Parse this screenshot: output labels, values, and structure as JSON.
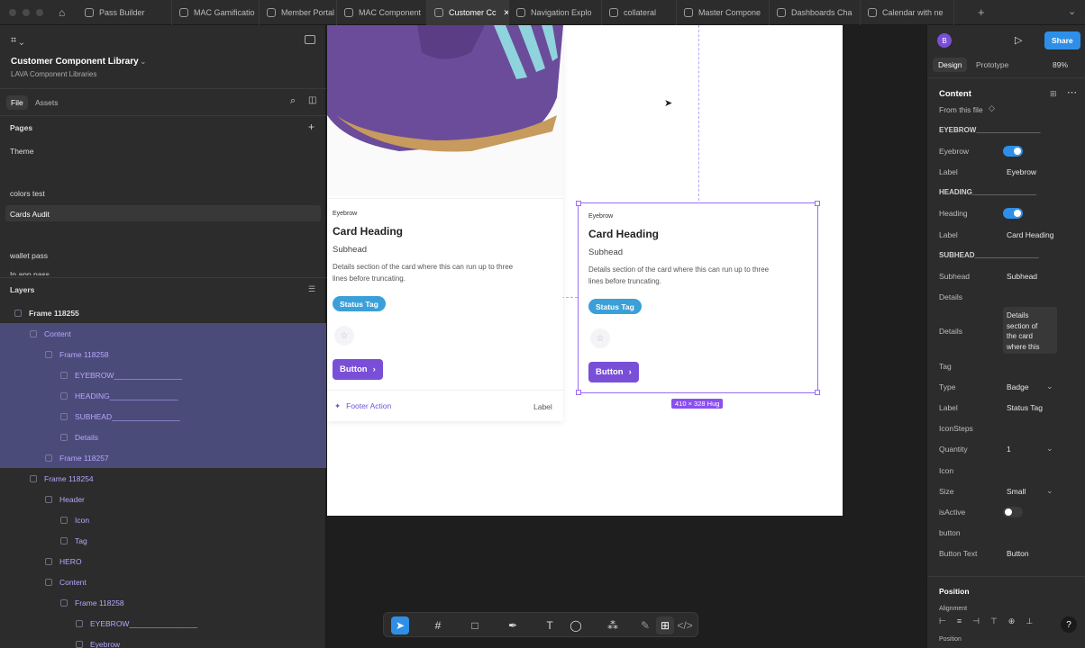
{
  "tabs": [
    {
      "label": "Pass Builder"
    },
    {
      "label": "MAC Gamificatio"
    },
    {
      "label": "Member Portal"
    },
    {
      "label": "MAC Component"
    },
    {
      "label": "Customer Cc",
      "active": true
    },
    {
      "label": "Navigation Explo"
    },
    {
      "label": "collateral"
    },
    {
      "label": "Master Compone"
    },
    {
      "label": "Dashboards Cha"
    },
    {
      "label": "Calendar with ne"
    }
  ],
  "file": {
    "title": "Customer Component Library",
    "subtitle": "LAVA Component Libraries",
    "tab_file": "File",
    "tab_assets": "Assets"
  },
  "pages": {
    "header": "Pages",
    "items": [
      "Theme",
      "colors test",
      "Cards Audit",
      "wallet pass",
      "In app pass"
    ]
  },
  "layers": {
    "header": "Layers",
    "items": [
      {
        "label": "Frame 118255",
        "indent": 0
      },
      {
        "label": "Content",
        "indent": 1,
        "sel": true
      },
      {
        "label": "Frame 118258",
        "indent": 2,
        "sel": true
      },
      {
        "label": "EYEBROW________________",
        "indent": 3,
        "sel": true
      },
      {
        "label": "HEADING________________",
        "indent": 3,
        "sel": true
      },
      {
        "label": "SUBHEAD________________",
        "indent": 3,
        "sel": true
      },
      {
        "label": "Details",
        "indent": 3,
        "sel": true
      },
      {
        "label": "Frame 118257",
        "indent": 2,
        "sel": true
      },
      {
        "label": "Frame 118254",
        "indent": 1
      },
      {
        "label": "Header",
        "indent": 2
      },
      {
        "label": "Icon",
        "indent": 3
      },
      {
        "label": "Tag",
        "indent": 3
      },
      {
        "label": "HERO",
        "indent": 2
      },
      {
        "label": "Content",
        "indent": 2
      },
      {
        "label": "Frame 118258",
        "indent": 3
      },
      {
        "label": "EYEBROW________________",
        "indent": 4
      },
      {
        "label": "Eyebrow",
        "indent": 4
      }
    ]
  },
  "card1": {
    "eyebrow": "Eyebrow",
    "heading": "Card Heading",
    "subhead": "Subhead",
    "details_1": "Details section of the card where this can run up to three",
    "details_2": "lines before truncating.",
    "tag": "Status Tag",
    "button": "Button",
    "footer_action": "Footer Action",
    "footer_label": "Label"
  },
  "card2": {
    "eyebrow": "Eyebrow",
    "heading": "Card Heading",
    "subhead": "Subhead",
    "details_1": "Details section of the card where this can run up to three",
    "details_2": "lines before truncating.",
    "tag": "Status Tag",
    "button": "Button",
    "size_badge": "410 × 328 Hug"
  },
  "right": {
    "avatar": "B",
    "share": "Share",
    "tab_design": "Design",
    "tab_prototype": "Prototype",
    "zoom": "89%",
    "content": "Content",
    "from_file": "From this file",
    "eyebrow_sec": "EYEBROW________________",
    "eyebrow_toggle": "Eyebrow",
    "label": "Label",
    "eyebrow_label": "Eyebrow",
    "heading_sec": "HEADING________________",
    "heading_toggle": "Heading",
    "heading_label": "Card Heading",
    "subhead_sec": "SUBHEAD________________",
    "subhead_key": "Subhead",
    "subhead_val": "Subhead",
    "details_sec": "Details",
    "details_key": "Details",
    "details_val_1": "Details",
    "details_val_2": "section of",
    "details_val_3": "the card",
    "details_val_4": "where this",
    "tag_sec": "Tag",
    "type_key": "Type",
    "type_val": "Badge",
    "tag_label_val": "Status Tag",
    "iconsteps_sec": "IconSteps",
    "qty_key": "Quantity",
    "qty_val": "1",
    "icon_sec": "Icon",
    "size_key": "Size",
    "size_val": "Small",
    "isactive_key": "isActive",
    "button_sec": "button",
    "btn_text_key": "Button Text",
    "btn_text_val": "Button",
    "position": "Position",
    "alignment": "Alignment",
    "position2": "Position"
  },
  "colors": {
    "accent": "#7a4fd8",
    "tag": "#3b9fd8",
    "selection": "#4b4b7a",
    "toggle_on": "#2f8fe8"
  }
}
